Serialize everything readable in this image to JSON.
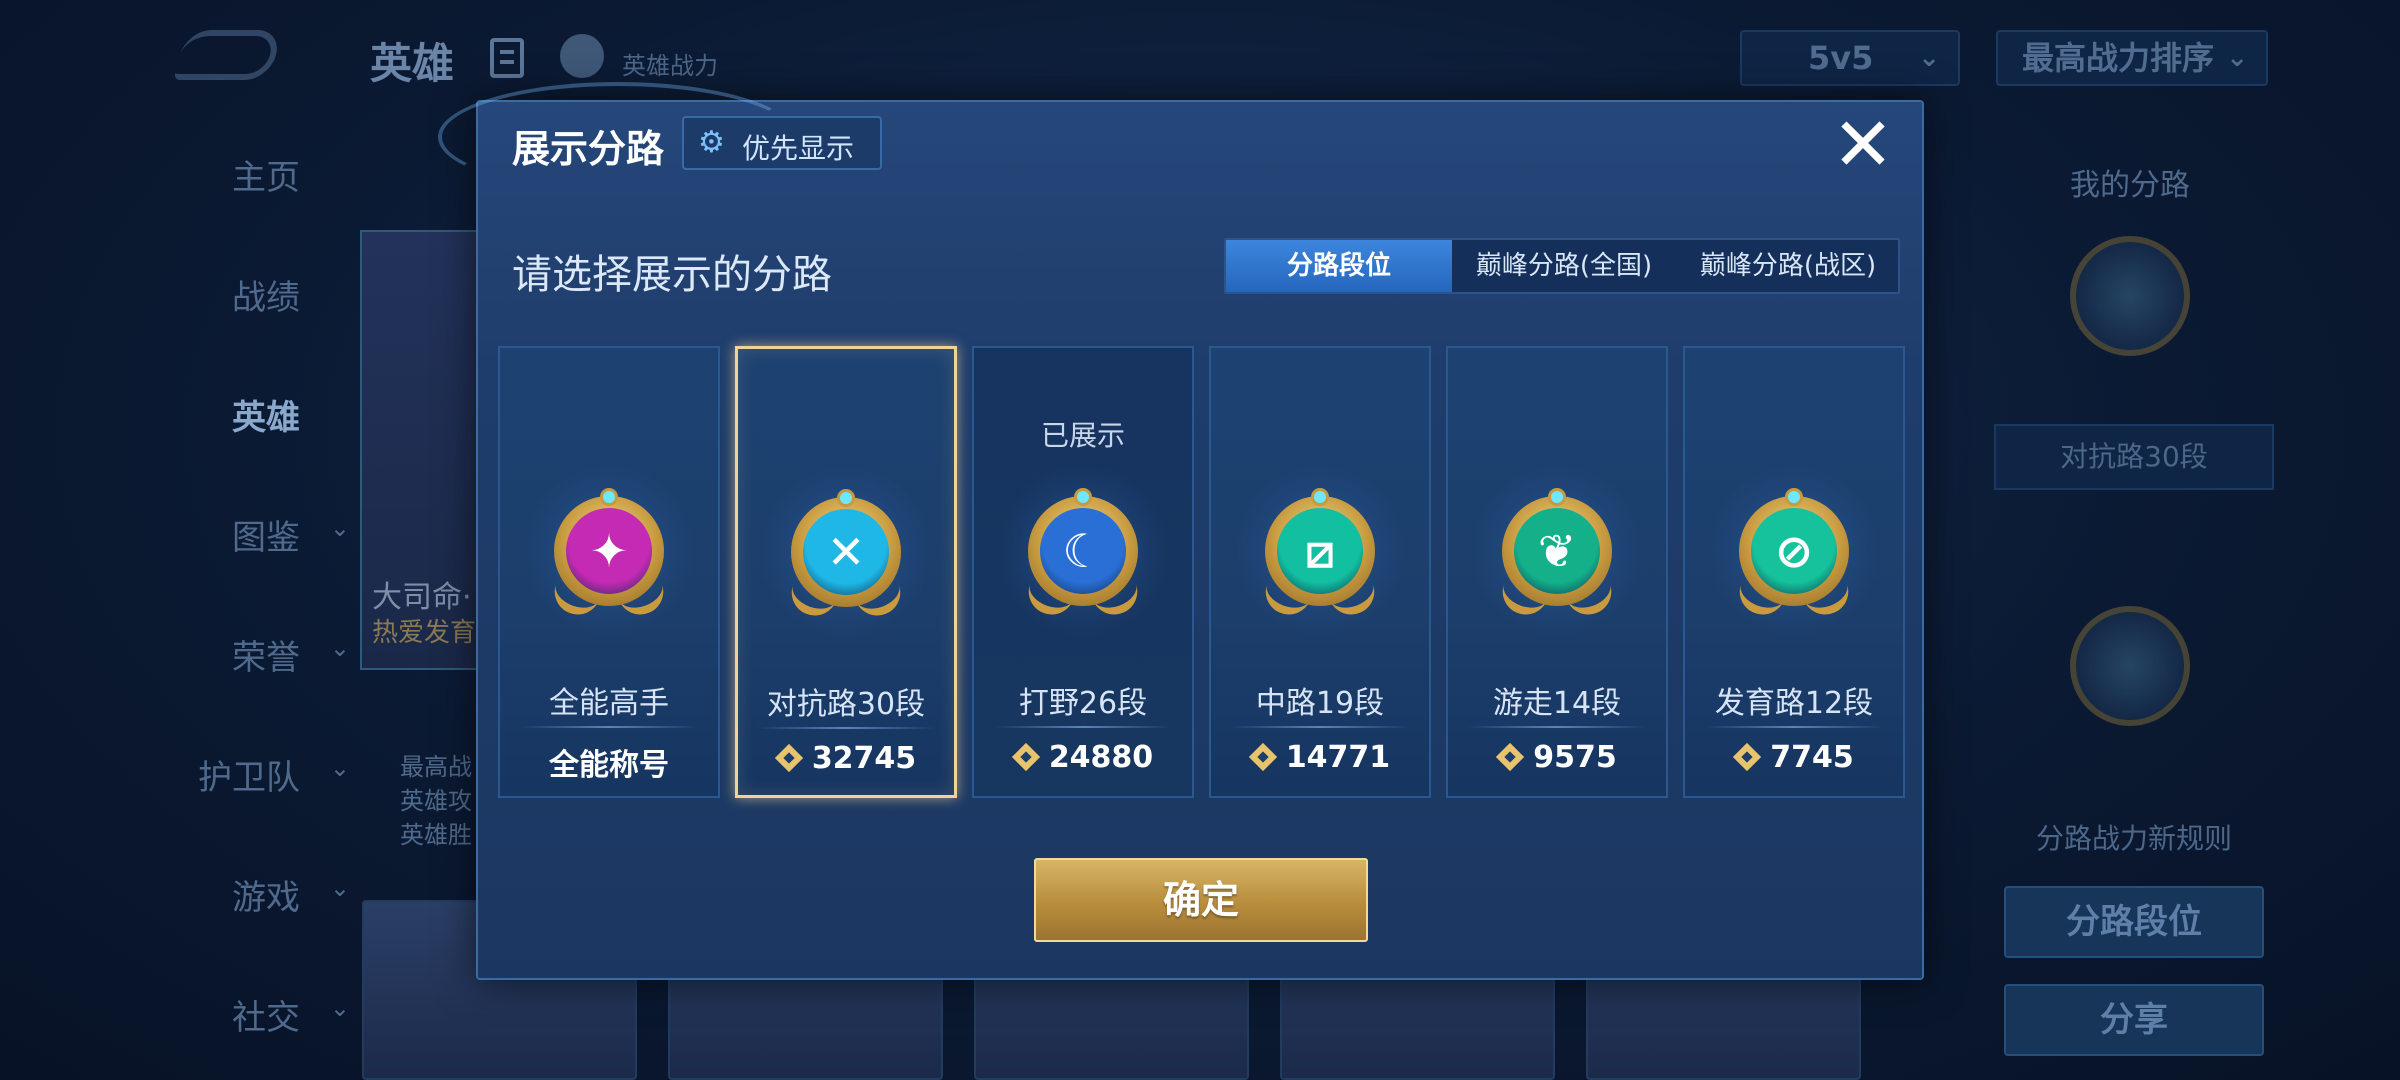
{
  "background": {
    "header": {
      "title": "英雄",
      "power_label": "英雄战力",
      "mode_select": "5v5",
      "sort_select": "最高战力排序"
    },
    "nav": [
      "主页",
      "战绩",
      "英雄",
      "图鉴",
      "荣誉",
      "护卫队",
      "游戏",
      "社交"
    ],
    "nav_active": "英雄",
    "hero_card": {
      "name": "大司命·",
      "subtitle": "热爱发育",
      "stats": [
        "最高战",
        "英雄攻",
        "英雄胜"
      ]
    },
    "right_panel": {
      "title": "我的分路",
      "lane_label": "对抗路30段",
      "rule_note": "分路战力新规则",
      "lane_rank_button": "分路段位",
      "share_button": "分享"
    }
  },
  "modal": {
    "title": "展示分路",
    "priority_button": "优先显示",
    "subtitle": "请选择展示的分路",
    "tabs": [
      {
        "label": "分路段位",
        "active": true
      },
      {
        "label": "巅峰分路(全国)",
        "active": false
      },
      {
        "label": "巅峰分路(战区)",
        "active": false
      }
    ],
    "lanes": [
      {
        "name": "全能高手",
        "value": "全能称号",
        "glyph": "✦",
        "color": "#c42ab3",
        "shown": "",
        "selected": false
      },
      {
        "name": "对抗路30段",
        "value": "32745",
        "glyph": "✕",
        "color": "#1fb7e6",
        "shown": "",
        "selected": true
      },
      {
        "name": "打野26段",
        "value": "24880",
        "glyph": "☾",
        "color": "#2a6fd6",
        "shown": "已展示",
        "selected": false
      },
      {
        "name": "中路19段",
        "value": "14771",
        "glyph": "⧄",
        "color": "#12bfa1",
        "shown": "",
        "selected": false
      },
      {
        "name": "游走14段",
        "value": "9575",
        "glyph": "❦",
        "color": "#14b08a",
        "shown": "",
        "selected": false
      },
      {
        "name": "发育路12段",
        "value": "7745",
        "glyph": "⊘",
        "color": "#16c29b",
        "shown": "",
        "selected": false
      }
    ],
    "confirm_button": "确定",
    "close_icon": "close-icon"
  }
}
